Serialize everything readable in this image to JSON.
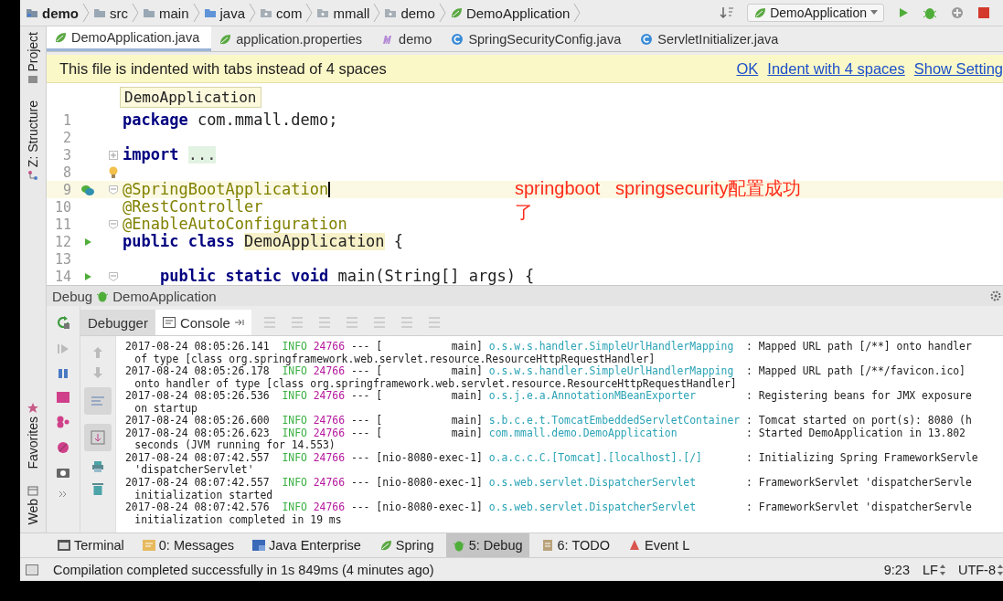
{
  "breadcrumbs": [
    {
      "label": "demo",
      "kind": "module"
    },
    {
      "label": "src",
      "kind": "folder"
    },
    {
      "label": "main",
      "kind": "folder"
    },
    {
      "label": "java",
      "kind": "source"
    },
    {
      "label": "com",
      "kind": "package"
    },
    {
      "label": "mmall",
      "kind": "package"
    },
    {
      "label": "demo",
      "kind": "package"
    },
    {
      "label": "DemoApplication",
      "kind": "spring"
    }
  ],
  "run_config": {
    "label": "DemoApplication"
  },
  "side_tools_top": [
    {
      "label": "Project",
      "kind": "project"
    },
    {
      "label": "Z: Structure",
      "kind": "structure"
    }
  ],
  "side_tools_bottom": [
    {
      "label": "Favorites",
      "kind": "favorites"
    },
    {
      "label": "Web",
      "kind": "web"
    }
  ],
  "editor_tabs": [
    {
      "label": "DemoApplication.java",
      "kind": "spring",
      "selected": true
    },
    {
      "label": "application.properties",
      "kind": "spring",
      "selected": false
    },
    {
      "label": "demo",
      "kind": "module",
      "selected": false
    },
    {
      "label": "SpringSecurityConfig.java",
      "kind": "class",
      "selected": false
    },
    {
      "label": "ServletInitializer.java",
      "kind": "class",
      "selected": false
    }
  ],
  "notification": {
    "message": "This file is indented with tabs instead of 4 spaces",
    "actions": [
      "OK",
      "Indent with 4 spaces",
      "Show Setting"
    ]
  },
  "editor": {
    "scope_hint": "DemoApplication",
    "lines": [
      {
        "number": "1",
        "current": false,
        "tokens": [
          {
            "text": "package",
            "kind": "keyword"
          },
          {
            "text": " com.mmall.demo;",
            "kind": "plain"
          }
        ]
      },
      {
        "number": "2",
        "current": false
      },
      {
        "number": "3",
        "current": false,
        "markers": [
          {
            "kind": "expand"
          }
        ],
        "tokens": [
          {
            "text": "import ",
            "kind": "keyword"
          },
          {
            "text": "...",
            "kind": "folded"
          }
        ]
      },
      {
        "number": "8",
        "current": false,
        "markers": [
          {
            "kind": "bulb"
          }
        ]
      },
      {
        "number": "9",
        "current": true,
        "markers": [
          {
            "kind": "bean"
          },
          {
            "kind": "collapse"
          }
        ],
        "tokens": [
          {
            "text": "@SpringBootApplication",
            "kind": "annotation"
          }
        ]
      },
      {
        "number": "10",
        "current": false,
        "tokens": [
          {
            "text": "@RestController",
            "kind": "annotation"
          }
        ]
      },
      {
        "number": "11",
        "current": false,
        "markers": [
          {
            "kind": "collapse"
          }
        ],
        "tokens": [
          {
            "text": "@EnableAutoConfiguration",
            "kind": "annotation"
          }
        ]
      },
      {
        "number": "12",
        "current": false,
        "markers": [
          {
            "kind": "run"
          }
        ],
        "tokens": [
          {
            "text": "public class ",
            "kind": "keyword"
          },
          {
            "text": "DemoApplication",
            "kind": "highlight"
          },
          {
            "text": " {",
            "kind": "plain"
          }
        ]
      },
      {
        "number": "13",
        "current": false
      },
      {
        "number": "14",
        "current": false,
        "markers": [
          {
            "kind": "run"
          },
          {
            "kind": "collapse"
          }
        ],
        "tokens": [
          {
            "text": "    public static void",
            "kind": "keyword"
          },
          {
            "text": " main(String[] args) {",
            "kind": "plain"
          }
        ]
      }
    ]
  },
  "annotation": "springboot   springsecurity配置成功了",
  "debug": {
    "title": "Debug",
    "config": "DemoApplication",
    "tabs": [
      {
        "label": "Debugger",
        "selected": false
      },
      {
        "label": "Console",
        "selected": true
      }
    ],
    "log": [
      {
        "time": "2017-08-24 08:05:26.141",
        "level": "INFO",
        "pid": "24766",
        "separator": "---",
        "thread": "[           main]",
        "logger": "o.s.w.s.handler.SimpleUrlHandlerMapping",
        "message": ": Mapped URL path [/**] onto handler",
        "continuation": "of type [class org.springframework.web.servlet.resource.ResourceHttpRequestHandler]"
      },
      {
        "time": "2017-08-24 08:05:26.178",
        "level": "INFO",
        "pid": "24766",
        "separator": "---",
        "thread": "[           main]",
        "logger": "o.s.w.s.handler.SimpleUrlHandlerMapping",
        "message": ": Mapped URL path [/**/favicon.ico]",
        "continuation": "onto handler of type [class org.springframework.web.servlet.resource.ResourceHttpRequestHandler]"
      },
      {
        "time": "2017-08-24 08:05:26.536",
        "level": "INFO",
        "pid": "24766",
        "separator": "---",
        "thread": "[           main]",
        "logger": "o.s.j.e.a.AnnotationMBeanExporter",
        "message": ": Registering beans for JMX exposure",
        "continuation": "on startup"
      },
      {
        "time": "2017-08-24 08:05:26.600",
        "level": "INFO",
        "pid": "24766",
        "separator": "---",
        "thread": "[           main]",
        "logger": "s.b.c.e.t.TomcatEmbeddedServletContainer",
        "message": ": Tomcat started on port(s): 8080 (h"
      },
      {
        "time": "2017-08-24 08:05:26.623",
        "level": "INFO",
        "pid": "24766",
        "separator": "---",
        "thread": "[           main]",
        "logger": "com.mmall.demo.DemoApplication",
        "message": ": Started DemoApplication in 13.802",
        "continuation": "seconds (JVM running for 14.553)"
      },
      {
        "time": "2017-08-24 08:07:42.557",
        "level": "INFO",
        "pid": "24766",
        "separator": "---",
        "thread": "[nio-8080-exec-1]",
        "logger": "o.a.c.c.C.[Tomcat].[localhost].[/]",
        "message": ": Initializing Spring FrameworkServle",
        "continuation": "'dispatcherServlet'"
      },
      {
        "time": "2017-08-24 08:07:42.557",
        "level": "INFO",
        "pid": "24766",
        "separator": "---",
        "thread": "[nio-8080-exec-1]",
        "logger": "o.s.web.servlet.DispatcherServlet",
        "message": ": FrameworkServlet 'dispatcherServle",
        "continuation": "initialization started"
      },
      {
        "time": "2017-08-24 08:07:42.576",
        "level": "INFO",
        "pid": "24766",
        "separator": "---",
        "thread": "[nio-8080-exec-1]",
        "logger": "o.s.web.servlet.DispatcherServlet",
        "message": ": FrameworkServlet 'dispatcherServle",
        "continuation": "initialization completed in 19 ms"
      }
    ]
  },
  "tool_windows": [
    {
      "label": "Terminal",
      "kind": "terminal",
      "selected": false
    },
    {
      "label": "0: Messages",
      "kind": "messages",
      "selected": false
    },
    {
      "label": "Java Enterprise",
      "kind": "enterprise",
      "selected": false
    },
    {
      "label": "Spring",
      "kind": "spring",
      "selected": false
    },
    {
      "label": "5: Debug",
      "kind": "debug",
      "selected": true
    },
    {
      "label": "6: TODO",
      "kind": "todo",
      "selected": false
    },
    {
      "label": "Event L",
      "kind": "event",
      "selected": false
    }
  ],
  "status": {
    "message": "Compilation completed successfully in 1s 849ms (4 minutes ago)",
    "position": "9:23",
    "line_separator": "LF",
    "encoding": "UTF-8"
  }
}
